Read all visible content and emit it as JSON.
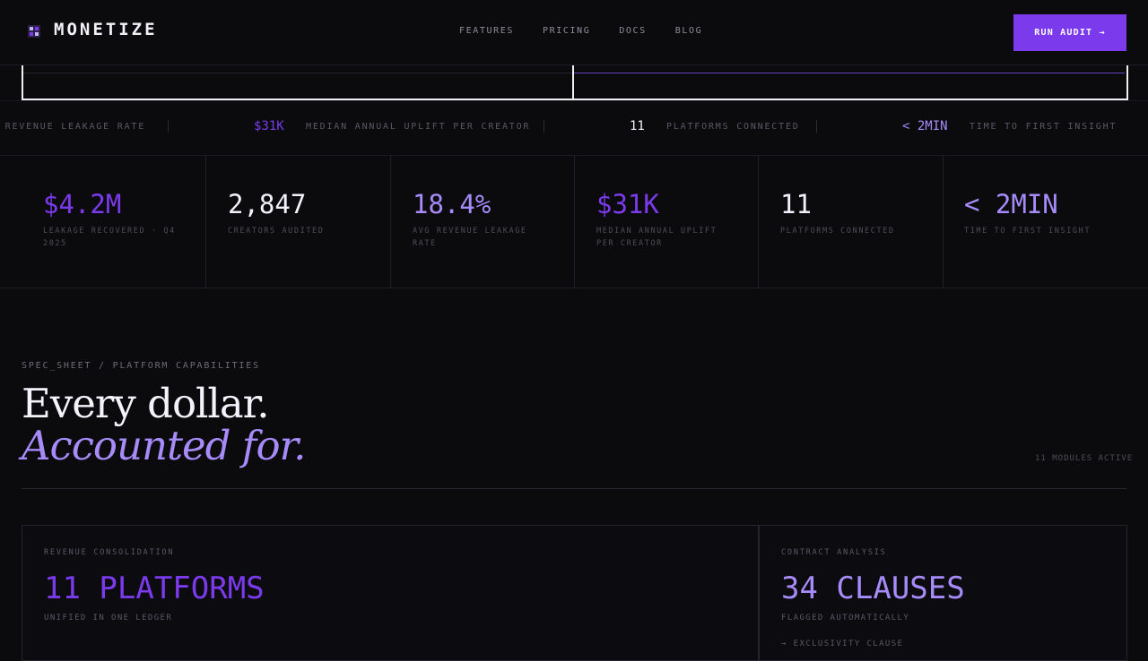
{
  "brand": {
    "name": "MONETIZE",
    "logo_icon": "monetize-logo-icon"
  },
  "nav": {
    "links": [
      "FEATURES",
      "PRICING",
      "DOCS",
      "BLOG"
    ],
    "cta_label": "RUN AUDIT →"
  },
  "ticker": {
    "items": [
      {
        "label": "G REVENUE LEAKAGE RATE"
      },
      {
        "value": "$31K",
        "label": "MEDIAN ANNUAL UPLIFT PER CREATOR"
      },
      {
        "value": "11",
        "label": "PLATFORMS CONNECTED"
      },
      {
        "value": "< 2MIN",
        "label": "TIME TO FIRST INSIGHT"
      }
    ]
  },
  "stats": [
    {
      "value": "$4.2M",
      "label": "LEAKAGE RECOVERED · Q4 2025",
      "color": "#7c3aed"
    },
    {
      "value": "2,847",
      "label": "CREATORS AUDITED",
      "color": "#f2f0f8"
    },
    {
      "value": "18.4%",
      "label": "AVG REVENUE LEAKAGE RATE",
      "color": "#a78bfa"
    },
    {
      "value": "$31K",
      "label": "MEDIAN ANNUAL UPLIFT PER CREATOR",
      "color": "#7c3aed"
    },
    {
      "value": "11",
      "label": "PLATFORMS CONNECTED",
      "color": "#f2f0f8"
    },
    {
      "value": "< 2MIN",
      "label": "TIME TO FIRST INSIGHT",
      "color": "#a78bfa"
    }
  ],
  "section": {
    "eyebrow": "SPEC_SHEET / PLATFORM CAPABILITIES",
    "headline_line1": "Every dollar.",
    "headline_line2": "Accounted for.",
    "modules_count": "11 MODULES ACTIVE"
  },
  "cards": [
    {
      "label": "REVENUE CONSOLIDATION",
      "big": "11 PLATFORMS",
      "sub": "UNIFIED IN ONE LEDGER",
      "color": "#7c3aed"
    },
    {
      "label": "CONTRACT ANALYSIS",
      "big": "34 CLAUSES",
      "sub": "FLAGGED AUTOMATICALLY",
      "extra": "→ EXCLUSIVITY CLAUSE",
      "color": "#a78bfa"
    }
  ],
  "colors": {
    "accent": "#7c3aed",
    "accent_light": "#a78bfa",
    "background": "#0b0b0e"
  }
}
